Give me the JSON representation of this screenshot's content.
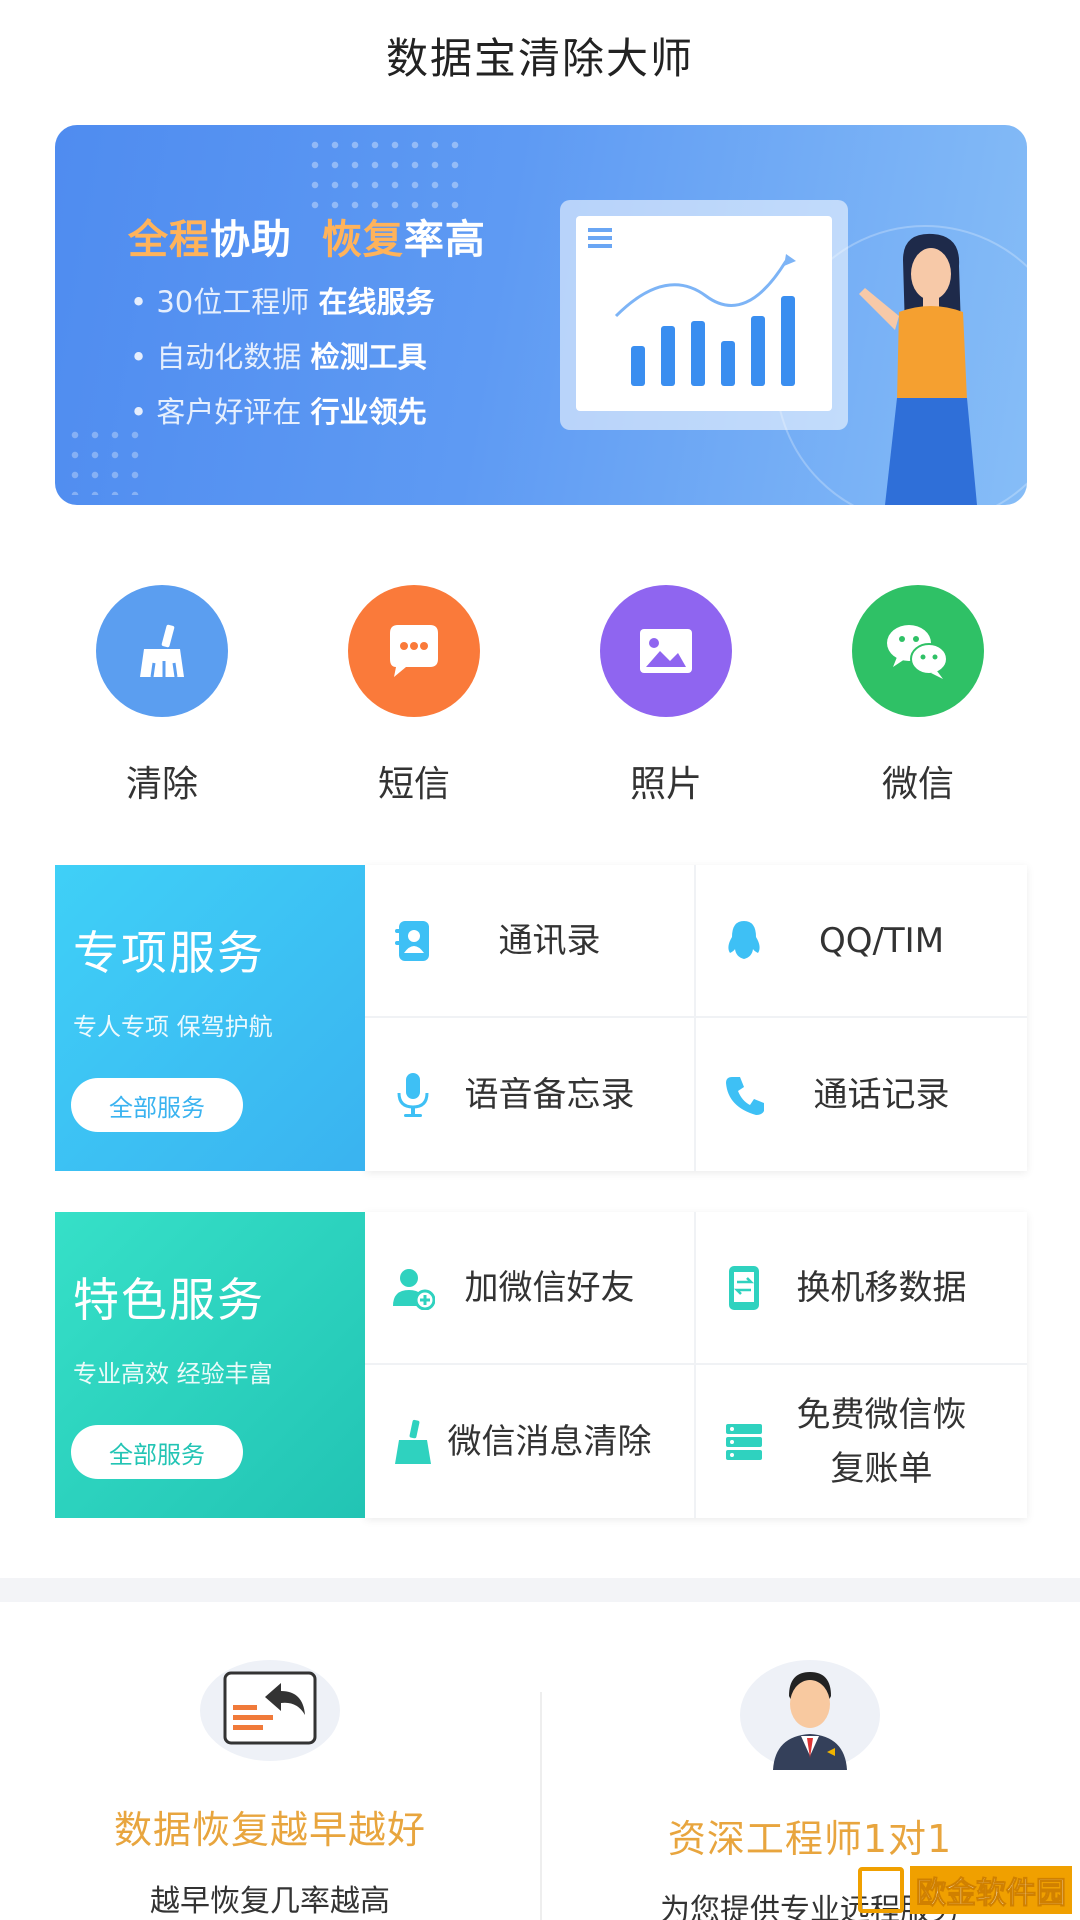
{
  "app": {
    "title": "数据宝清除大师"
  },
  "banner": {
    "headline_parts": [
      "全程",
      "协助",
      "恢复",
      "率高"
    ],
    "bullets": [
      {
        "normal": "30位工程师",
        "bold": "在线服务"
      },
      {
        "normal": "自动化数据",
        "bold": "检测工具"
      },
      {
        "normal": "客户好评在",
        "bold": "行业领先"
      }
    ],
    "colors": {
      "gradient_start": "#4f8cf0",
      "gradient_end": "#86bdf7",
      "highlight": "#ffb35a"
    }
  },
  "quick_actions": [
    {
      "label": "清除",
      "icon": "broom-icon",
      "color": "#5b9ef0"
    },
    {
      "label": "短信",
      "icon": "chat-bubble-icon",
      "color": "#fa7a3a"
    },
    {
      "label": "照片",
      "icon": "photo-icon",
      "color": "#8f65f0"
    },
    {
      "label": "微信",
      "icon": "wechat-icon",
      "color": "#2fc166"
    }
  ],
  "special_service": {
    "title": "专项服务",
    "subtitle": "专人专项 保驾护航",
    "button": "全部服务",
    "color": "#3ec0f5",
    "items": [
      {
        "label": "通讯录",
        "icon": "contacts-icon"
      },
      {
        "label": "QQ/TIM",
        "icon": "qq-penguin-icon"
      },
      {
        "label": "语音备忘录",
        "icon": "microphone-icon"
      },
      {
        "label": "通话记录",
        "icon": "phone-icon"
      }
    ]
  },
  "featured_service": {
    "title": "特色服务",
    "subtitle": "专业高效 经验丰富",
    "button": "全部服务",
    "color": "#2fd2bf",
    "items": [
      {
        "label": "加微信好友",
        "icon": "add-friend-icon"
      },
      {
        "label": "换机移数据",
        "icon": "phone-transfer-icon"
      },
      {
        "label": "微信消息清除",
        "icon": "broom-icon"
      },
      {
        "label": "免费微信恢复账单",
        "icon": "bill-list-icon"
      }
    ]
  },
  "bottom_cards": [
    {
      "title": "数据恢复越早越好",
      "subtitle": "越早恢复几率越高",
      "icon": "restore-icon"
    },
    {
      "title": "资深工程师1对1",
      "subtitle": "为您提供专业远程服务",
      "icon": "engineer-avatar-icon"
    }
  ],
  "watermark": {
    "text": "欧金软件园"
  }
}
